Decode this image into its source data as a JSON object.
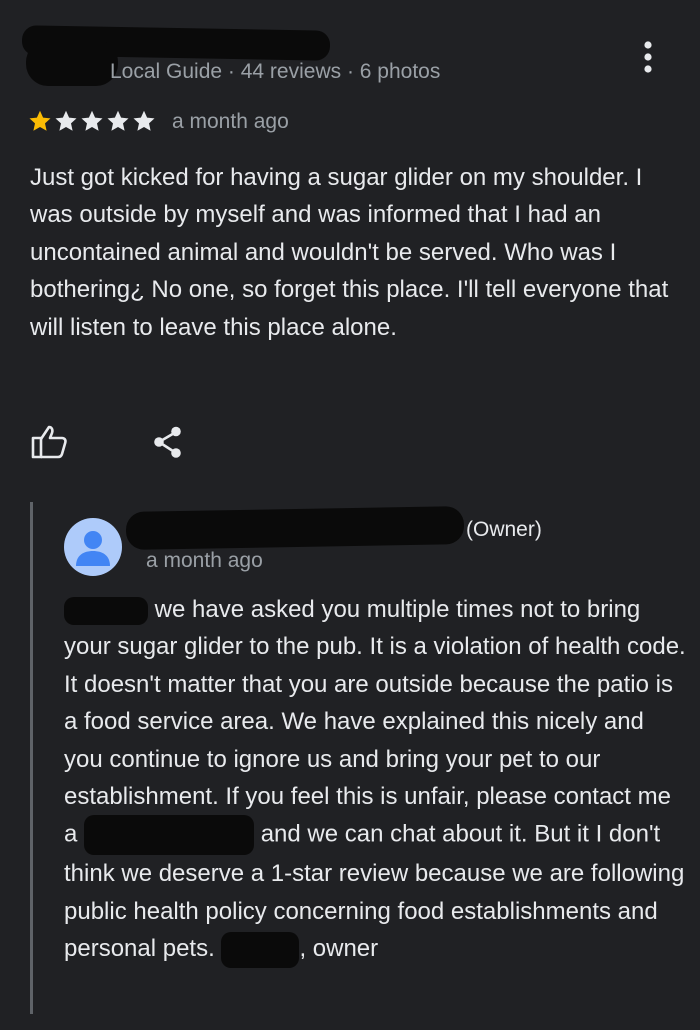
{
  "reviewer": {
    "meta": "Local Guide · 44 reviews · 6 photos"
  },
  "review": {
    "rating": 1,
    "max_rating": 5,
    "date": "a month ago",
    "text": "Just got kicked for having a sugar glider on my shoulder. I was outside by myself and was informed that I had an uncontained animal and wouldn't be served. Who was I bothering¿ No one, so forget this place. I'll tell everyone that will listen to leave this place alone."
  },
  "reply": {
    "owner_label": "(Owner)",
    "date": "a month ago",
    "text_part1": "we have asked you multiple times not to bring your sugar glider to the pub. It is a violation of health code. It doesn't matter that you are outside because the patio is a food service area. We have explained this nicely and you continue to ignore us and bring your pet to our establishment. If you feel this is unfair, please contact me a",
    "text_part2": "and we can chat about it. But it I don't think we deserve a 1-star review because we are following public health policy concerning food establishments and personal pets.",
    "text_part3": ", owner"
  },
  "colors": {
    "background": "#202124",
    "star_filled": "#fbbc04",
    "star_empty": "#e8eaed",
    "text_primary": "#e8eaed",
    "text_secondary": "#9aa0a6",
    "avatar": "#aecbfa"
  },
  "icons": {
    "more": "more-vert-icon",
    "like": "thumb-up-icon",
    "share": "share-icon",
    "avatar": "person-icon"
  }
}
